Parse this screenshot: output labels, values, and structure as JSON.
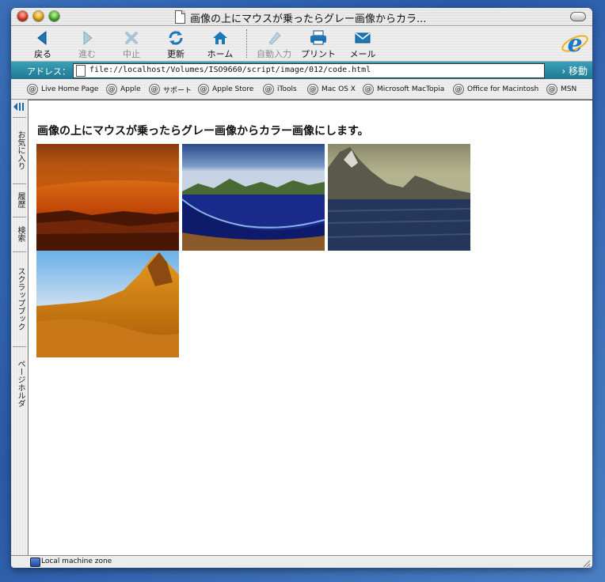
{
  "window": {
    "title": "画像の上にマウスが乗ったらグレー画像からカラ..."
  },
  "toolbar": {
    "back": "戻る",
    "forward": "進む",
    "stop": "中止",
    "refresh": "更新",
    "home": "ホーム",
    "autofill": "自動入力",
    "print": "プリント",
    "mail": "メール"
  },
  "address": {
    "label": "アドレス：",
    "url": "file://localhost/Volumes/ISO9660/script/image/012/code.html",
    "go": "移動"
  },
  "favorites": [
    "Live Home Page",
    "Apple",
    "サポート",
    "Apple Store",
    "iTools",
    "Mac OS X",
    "Microsoft MacTopia",
    "Office for Macintosh",
    "MSN"
  ],
  "sidebar": {
    "tabs": [
      "お気に入り",
      "履歴",
      "検索",
      "スクラップブック",
      "ページホルダ"
    ]
  },
  "page": {
    "heading": "画像の上にマウスが乗ったらグレー画像からカラー画像にします。",
    "images": [
      "sunset-landscape",
      "coastal-bay",
      "mountain-lake",
      "desert-mountain"
    ]
  },
  "status": {
    "zone": "Local machine zone"
  },
  "colors": {
    "address_bar": "#2b8ca4",
    "heading": "#111111"
  }
}
